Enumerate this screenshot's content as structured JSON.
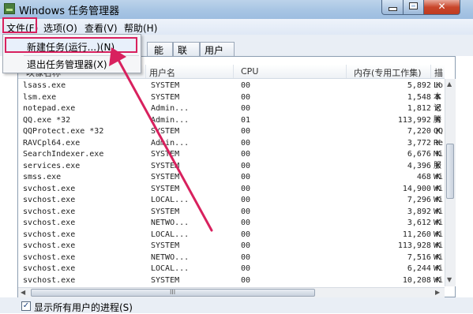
{
  "window": {
    "title": "Windows 任务管理器"
  },
  "menubar": {
    "file": "文件(F)",
    "options": "选项(O)",
    "view": "查看(V)",
    "help": "帮助(H)"
  },
  "file_menu": {
    "new_task": "新建任务(运行...)(N)",
    "exit": "退出任务管理器(X)"
  },
  "tabs": {
    "performance": "能",
    "network": "联网",
    "users": "用户"
  },
  "columns": {
    "image_name": "映像名称",
    "user_name": "用户名",
    "cpu": "CPU",
    "memory": "内存(专用工作集)",
    "desc": "描"
  },
  "processes": [
    {
      "name": "lsass.exe",
      "user": "SYSTEM",
      "cpu": "00",
      "mem": "5,892 K",
      "desc": "Lo"
    },
    {
      "name": "lsm.exe",
      "user": "SYSTEM",
      "cpu": "00",
      "mem": "1,548 K",
      "desc": "本"
    },
    {
      "name": "notepad.exe",
      "user": "Admin...",
      "cpu": "00",
      "mem": "1,812 K",
      "desc": "记"
    },
    {
      "name": "QQ.exe *32",
      "user": "Admin...",
      "cpu": "01",
      "mem": "113,992 K",
      "desc": "腾"
    },
    {
      "name": "QQProtect.exe *32",
      "user": "SYSTEM",
      "cpu": "00",
      "mem": "7,220 K",
      "desc": "QQ"
    },
    {
      "name": "RAVCpl64.exe",
      "user": "Admin...",
      "cpu": "00",
      "mem": "3,772 K",
      "desc": "Re"
    },
    {
      "name": "SearchIndexer.exe",
      "user": "SYSTEM",
      "cpu": "00",
      "mem": "6,676 K",
      "desc": "Mi"
    },
    {
      "name": "services.exe",
      "user": "SYSTEM",
      "cpu": "00",
      "mem": "4,396 K",
      "desc": "服"
    },
    {
      "name": "smss.exe",
      "user": "SYSTEM",
      "cpu": "00",
      "mem": "468 K",
      "desc": "Wi"
    },
    {
      "name": "svchost.exe",
      "user": "SYSTEM",
      "cpu": "00",
      "mem": "14,900 K",
      "desc": "Wi"
    },
    {
      "name": "svchost.exe",
      "user": "LOCAL...",
      "cpu": "00",
      "mem": "7,296 K",
      "desc": "Wi"
    },
    {
      "name": "svchost.exe",
      "user": "SYSTEM",
      "cpu": "00",
      "mem": "3,892 K",
      "desc": "Wi"
    },
    {
      "name": "svchost.exe",
      "user": "NETWO...",
      "cpu": "00",
      "mem": "3,612 K",
      "desc": "Wi"
    },
    {
      "name": "svchost.exe",
      "user": "LOCAL...",
      "cpu": "00",
      "mem": "11,260 K",
      "desc": "Wi"
    },
    {
      "name": "svchost.exe",
      "user": "SYSTEM",
      "cpu": "00",
      "mem": "113,928 K",
      "desc": "Wi"
    },
    {
      "name": "svchost.exe",
      "user": "NETWO...",
      "cpu": "00",
      "mem": "7,516 K",
      "desc": "Wi"
    },
    {
      "name": "svchost.exe",
      "user": "LOCAL...",
      "cpu": "00",
      "mem": "6,244 K",
      "desc": "Wi"
    },
    {
      "name": "svchost.exe",
      "user": "SYSTEM",
      "cpu": "00",
      "mem": "10,208 K",
      "desc": "Wi"
    }
  ],
  "hscroll_grip": "III",
  "bottom": {
    "show_all": "显示所有用户的进程(S)"
  },
  "colors": {
    "annotation": "#d8215e",
    "titlebar": "#a9c6e4",
    "close_button": "#c9462c"
  }
}
